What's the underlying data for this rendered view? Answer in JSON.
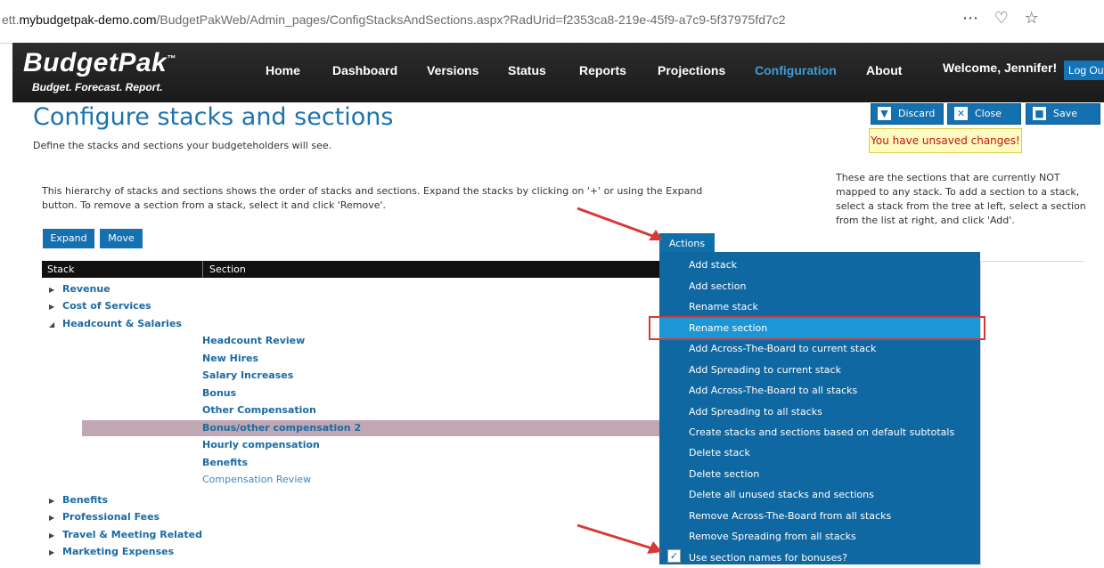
{
  "browser": {
    "url_prefix": "ett.",
    "url_domain": "mybudgetpak-demo.com",
    "url_path": "/BudgetPakWeb/Admin_pages/ConfigStacksAndSections.aspx?RadUrid=f2353ca8-219e-45f9-a7c9-5f37975fd7c2",
    "icons": [
      "more-icon",
      "pocket-icon",
      "star-icon"
    ]
  },
  "header": {
    "logo": "BudgetPak",
    "logo_tm": "™",
    "tagline": "Budget. Forecast. Report.",
    "nav": [
      {
        "label": "Home"
      },
      {
        "label": "Dashboard"
      },
      {
        "label": "Versions"
      },
      {
        "label": "Status"
      },
      {
        "label": "Reports"
      },
      {
        "label": "Projections"
      },
      {
        "label": "Configuration"
      },
      {
        "label": "About"
      }
    ],
    "active_nav": "Configuration",
    "welcome": "Welcome, Jennifer!",
    "logout": "Log Out"
  },
  "page": {
    "title": "Configure stacks and sections",
    "subtitle": "Define the stacks and sections your budgeteholders will see.",
    "intro": "This hierarchy of stacks and sections shows the order of stacks and sections. Expand the stacks by clicking on '+' or using the Expand button. To remove a section from a stack, select it and click 'Remove'.",
    "right_help": "These are the sections that are currently NOT mapped to any stack. To add a section to a stack, select a stack from the tree at left, select a section from the list at right, and click 'Add'."
  },
  "toolbar": {
    "discard": "Discard",
    "close": "Close",
    "save": "Save",
    "unsaved": "You have unsaved changes!"
  },
  "tree_buttons": {
    "expand": "Expand",
    "move": "Move"
  },
  "tree": {
    "col_stack": "Stack",
    "col_section": "Section",
    "stacks_top": [
      "Revenue",
      "Cost of Services",
      "Headcount & Salaries"
    ],
    "sections": [
      "Headcount Review",
      "New Hires",
      "Salary Increases",
      "Bonus",
      "Other Compensation",
      "Bonus/other compensation 2",
      "Hourly compensation",
      "Benefits",
      "Compensation Review"
    ],
    "selected_section": "Bonus/other compensation 2",
    "stacks_bottom": [
      "Benefits",
      "Professional Fees",
      "Travel & Meeting Related",
      "Marketing Expenses"
    ]
  },
  "actions": {
    "tab_label": "Actions",
    "items": [
      "Add stack",
      "Add section",
      "Rename stack",
      "Rename section",
      "Add Across-The-Board to current stack",
      "Add Spreading to current stack",
      "Add Across-The-Board to all stacks",
      "Add Spreading to all stacks",
      "Create stacks and sections based on default subtotals",
      "Delete stack",
      "Delete section",
      "Delete all unused stacks and sections",
      "Remove Across-The-Board from all stacks",
      "Remove Spreading from all stacks",
      "Use section names for bonuses?"
    ],
    "highlighted": "Rename section",
    "bonus_checked": true
  },
  "colors": {
    "brand_blue": "#1570b0",
    "menu_blue": "#1068a3",
    "menu_highlight": "#1d96d6",
    "annotation_red": "#d63a38"
  }
}
